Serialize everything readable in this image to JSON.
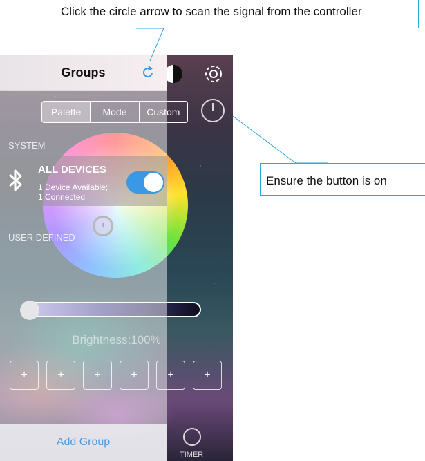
{
  "callouts": {
    "top": "Click the circle arrow to scan the signal from the controller",
    "right": "Ensure the button is on"
  },
  "panel": {
    "title": "Groups",
    "system_label": "SYSTEM",
    "device": {
      "name": "ALL DEVICES",
      "line1": "1 Device Available;",
      "line2": "1 Connected",
      "toggle_on": true
    },
    "user_defined_label": "USER DEFINED",
    "add_group": "Add Group"
  },
  "controls": {
    "tabs": [
      "Palette",
      "Mode",
      "Custom"
    ],
    "active_tab": "Palette",
    "brightness_label": "Brightness:100%",
    "brightness_value": 100,
    "preset_symbol": "+",
    "timer_label": "TIMER"
  },
  "icons": {
    "refresh": "refresh-icon",
    "power": "power-icon",
    "settings": "gear-icon",
    "bluetooth": "bluetooth-icon",
    "timer": "timer-icon"
  },
  "colors": {
    "accent": "#3b98e5",
    "callout_border": "#2aa8d8"
  }
}
